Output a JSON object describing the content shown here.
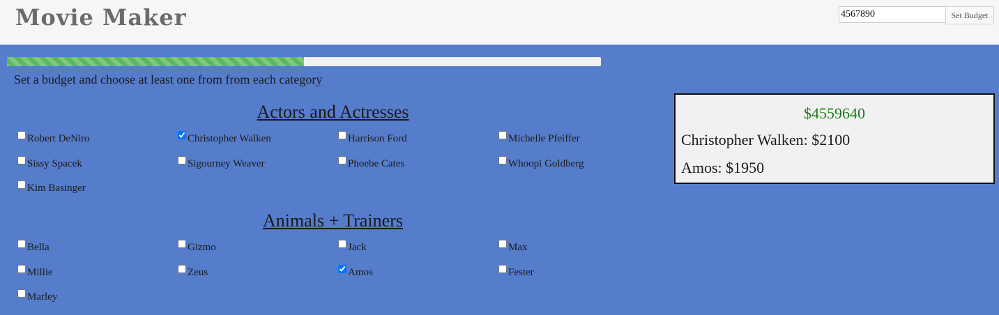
{
  "header": {
    "title": "Movie Maker",
    "budget_value": "4567890",
    "set_budget_label": "Set Budget"
  },
  "progress": {
    "fraction": 0.5,
    "color": "#5cb85c"
  },
  "instructions": "Set a budget and choose at least one from from each category",
  "categories": [
    {
      "title": "Actors and Actresses",
      "options": [
        {
          "label": "Robert DeNiro",
          "checked": false
        },
        {
          "label": "Christopher Walken",
          "checked": true
        },
        {
          "label": "Harrison Ford",
          "checked": false
        },
        {
          "label": "Michelle Pfeiffer",
          "checked": false
        },
        {
          "label": "Sissy Spacek",
          "checked": false
        },
        {
          "label": "Sigourney Weaver",
          "checked": false
        },
        {
          "label": "Phoebe Cates",
          "checked": false
        },
        {
          "label": "Whoopi Goldberg",
          "checked": false
        },
        {
          "label": "Kim Basinger",
          "checked": false
        }
      ]
    },
    {
      "title": "Animals + Trainers",
      "options": [
        {
          "label": "Bella",
          "checked": false
        },
        {
          "label": "Gizmo",
          "checked": false
        },
        {
          "label": "Jack",
          "checked": false
        },
        {
          "label": "Max",
          "checked": false
        },
        {
          "label": "Millie",
          "checked": false
        },
        {
          "label": "Zeus",
          "checked": false
        },
        {
          "label": "Amos",
          "checked": true
        },
        {
          "label": "Fester",
          "checked": false
        },
        {
          "label": "Marley",
          "checked": false
        }
      ]
    }
  ],
  "summary": {
    "remaining": "$4559640",
    "remaining_color": "#1a7a1a",
    "items": [
      "Christopher Walken: $2100",
      "Amos: $1950"
    ]
  },
  "colors": {
    "background": "#567dcb",
    "header": "#f6f6f6"
  }
}
